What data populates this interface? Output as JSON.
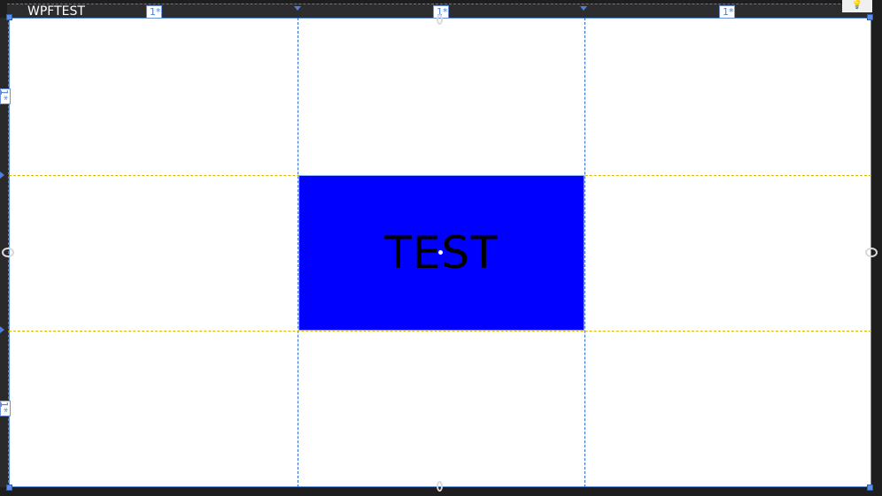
{
  "window": {
    "title": "WPFTEST"
  },
  "grid": {
    "column_sizes": [
      "1*",
      "1*",
      "1*"
    ],
    "row_sizes": [
      "1*",
      "1*",
      "1*"
    ],
    "center_cell_text": "TEST"
  },
  "colors": {
    "canvas_background": "#ffffff",
    "center_cell": "#0000ff",
    "gridline": "#2f6bd8",
    "dark_background": "#1e1e1e"
  },
  "icons": {
    "lightbulb": "lightbulb-icon"
  }
}
